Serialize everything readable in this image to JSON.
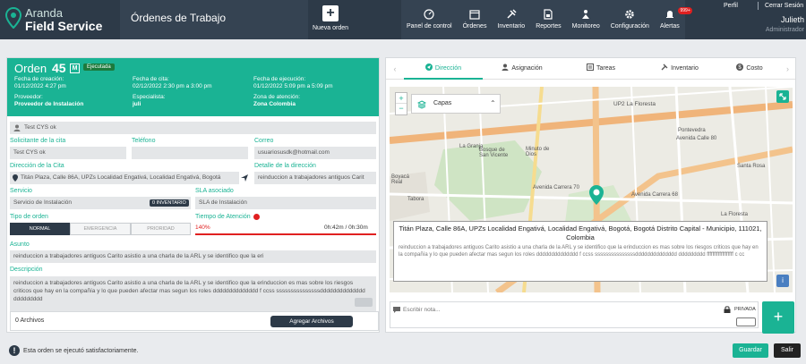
{
  "app": {
    "logo_line1": "Aranda",
    "logo_line2": "Field Service",
    "page_title": "Órdenes de Trabajo",
    "new_order": "Nueva orden"
  },
  "nav": [
    {
      "label": "Panel de control",
      "icon": "dashboard-icon"
    },
    {
      "label": "Órdenes",
      "icon": "calendar-icon"
    },
    {
      "label": "Inventario",
      "icon": "tools-icon"
    },
    {
      "label": "Reportes",
      "icon": "report-icon"
    },
    {
      "label": "Monitoreo",
      "icon": "monitor-icon"
    },
    {
      "label": "Configuración",
      "icon": "gear-icon"
    },
    {
      "label": "Alertas",
      "icon": "bell-icon",
      "badge": "999+"
    }
  ],
  "user": {
    "perfil": "Perfil",
    "cerrar": "Cerrar Sesión",
    "name": "Julieth",
    "role": "Administrador"
  },
  "order": {
    "title": "Orden",
    "number": "45",
    "m": "M",
    "status": "Ejecutada",
    "fecha_creacion_label": "Fecha de creación:",
    "fecha_creacion": "01/12/2022 4:27 pm",
    "fecha_cita_label": "Fecha de cita:",
    "fecha_cita": "02/12/2022 2:30 pm a 3:00 pm",
    "fecha_ejecucion_label": "Fecha de ejecución:",
    "fecha_ejecucion": "01/12/2022 5:09 pm a 5:09 pm",
    "proveedor_label": "Proveedor:",
    "proveedor": "Proveedor de Instalación",
    "especialista_label": "Especialista:",
    "especialista": "juli",
    "zona_label": "Zona de atención:",
    "zona": "Zona Colombia"
  },
  "form": {
    "client_name": "Test CYS ok",
    "solicitante_label": "Solicitante de la cita",
    "solicitante": "Test CYS ok",
    "telefono_label": "Teléfono",
    "telefono": "",
    "correo_label": "Correo",
    "correo": "usuariosusdk@hotmail.com",
    "direccion_label": "Dirección de la Cita",
    "direccion": "Titán Plaza, Calle 86A, UPZs Localidad Engativá, Localidad Engativá, Bogotá",
    "detalle_label": "Detalle de la dirección",
    "detalle": "reinduccion a trabajadores antiguos Carit",
    "servicio_label": "Servicio",
    "servicio": "Servicio de Instalación",
    "servicio_chip": "0 INVENTARIO",
    "sla_label": "SLA asociado",
    "sla": "SLA de Instalación",
    "tipo_label": "Tipo de orden",
    "tipo_normal": "NORMAL",
    "tipo_emergencia": "EMERGENCIA",
    "tipo_prioridad": "PRIORIDAD",
    "tiempo_label": "Tiempo de Atención",
    "tiempo_pct": "140%",
    "tiempo_val": "0h:42m / 0h:30m",
    "asunto_label": "Asunto",
    "asunto": "reinduccion a trabajadores antiguos Carito asistio a una charla de la ARL y se identifico que la eri",
    "descripcion_label": "Descripción",
    "descripcion": "reinduccion a trabajadores antiguos Carito asistio a una charla de la ARL y se identifico que la erinduccion es mas sobre los riesgos criticos que hay en la compañía y lo que pueden afectar mas segun los roles dddddddddddddd f ccss sssssssssssssssdddddddddddddd ddddddddd",
    "archivos": "0 Archivos",
    "agregar": "Agregar Archivos"
  },
  "tabs": [
    {
      "label": "Dirección",
      "icon": "send-icon"
    },
    {
      "label": "Asignación",
      "icon": "user-icon"
    },
    {
      "label": "Tareas",
      "icon": "tasks-icon"
    },
    {
      "label": "Inventario",
      "icon": "tools-icon"
    },
    {
      "label": "Costo",
      "icon": "money-icon"
    }
  ],
  "map": {
    "capas": "Capas",
    "popup_title": "Titán Plaza, Calle 86A, UPZs Localidad Engativá, Localidad Engativá, Bogotá, Bogotá Distrito Capital - Municipio, 111021, Colombia",
    "popup_text": "reinduccion a trabajadores antiguos Carito asistio a una charla de la ARL y se identifico que la erinduccion es mas sobre los riesgos criticos que hay en la compañía y lo que pueden afectar mas segun los roles dddddddddddddd f ccss sssssssssssssssdddddddddddddd ddddddddd fffffffffffffffffff c cc",
    "labels": [
      "La Granja",
      "Minuto de Dios",
      "Bosque de San Vicente",
      "UP2 La Floresta",
      "La Floresta",
      "Pontevedra",
      "Santa Rosa",
      "Boyacá Real",
      "Tabora",
      "Avenida Carrera 70",
      "Avenida Calle 80",
      "Avenida Carrera 68"
    ]
  },
  "note": {
    "placeholder": "Escribir nota...",
    "privada": "PRIVADA"
  },
  "footer": {
    "message": "Esta orden se ejecutó satisfactoriamente.",
    "guardar": "Guardar",
    "salir": "Salir"
  }
}
